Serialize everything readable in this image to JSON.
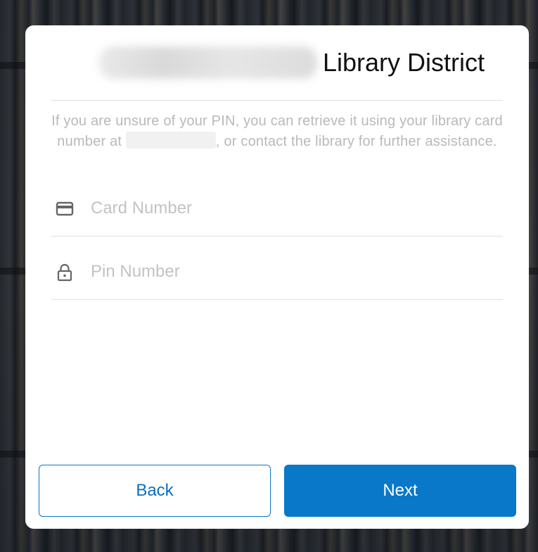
{
  "header": {
    "title": "Library District"
  },
  "help": {
    "text_before": "If you are unsure of your PIN, you can retrieve it using your library card number at",
    "text_after": ", or contact the library for further assistance."
  },
  "form": {
    "card_number": {
      "placeholder": "Card Number",
      "value": "",
      "icon": "credit-card-icon"
    },
    "pin_number": {
      "placeholder": "Pin Number",
      "value": "",
      "icon": "lock-icon"
    }
  },
  "actions": {
    "back_label": "Back",
    "next_label": "Next"
  },
  "colors": {
    "accent": "#0a78c8",
    "placeholder": "#c3c3c3",
    "help_text": "#b9b9b9"
  }
}
